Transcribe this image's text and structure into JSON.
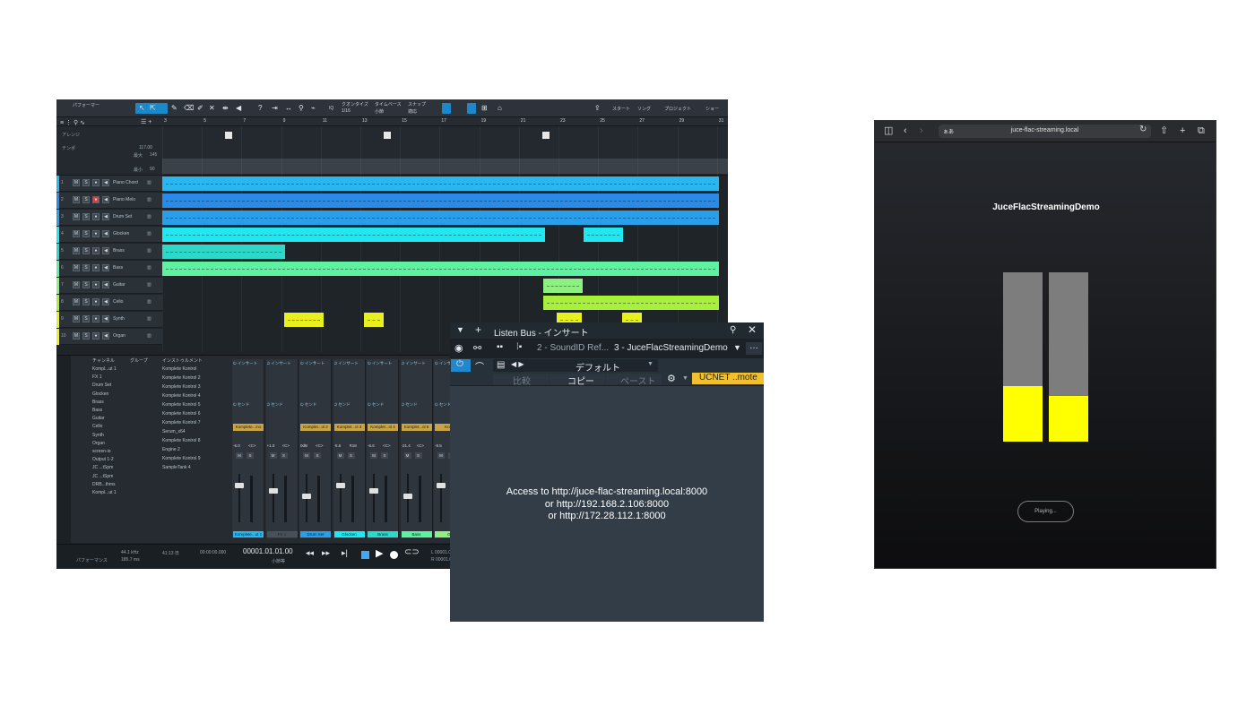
{
  "daw": {
    "toolbar": {
      "performance_label": "パフォーマー",
      "quantize_label": "クオンタイズ",
      "quantize_value": "1/16",
      "timebase_label": "タイムベース",
      "timebase_value": "小節",
      "snap_label": "スナップ",
      "snap_value": "適応",
      "start_label": "スタート",
      "song_label": "ソング",
      "project_label": "プロジェクト",
      "show_label": "ショー"
    },
    "ruler": [
      "3",
      "5",
      "7",
      "9",
      "11",
      "13",
      "15",
      "17",
      "19",
      "21",
      "23",
      "25",
      "27",
      "29",
      "31"
    ],
    "global": {
      "arranger_label": "アレンジ",
      "tempo_label": "テンポ",
      "tempo_value": "117.00",
      "max_label": "最大",
      "max_value": "145",
      "min_label": "最小",
      "min_value": "90"
    },
    "tracks": [
      {
        "num": "1",
        "name": "Piano Chord",
        "color": "#2ab7f0"
      },
      {
        "num": "2",
        "name": "Piano Melo",
        "color": "#2a8ae8"
      },
      {
        "num": "3",
        "name": "Drum Set",
        "color": "#2a9ee8"
      },
      {
        "num": "4",
        "name": "Glocken",
        "color": "#20e8f0"
      },
      {
        "num": "5",
        "name": "Brass",
        "color": "#2ed8c8"
      },
      {
        "num": "6",
        "name": "Bass",
        "color": "#5ef2a0"
      },
      {
        "num": "7",
        "name": "Guitar",
        "color": "#8ef080"
      },
      {
        "num": "8",
        "name": "Cello",
        "color": "#a8f03a"
      },
      {
        "num": "9",
        "name": "Synth",
        "color": "#e8f020"
      },
      {
        "num": "10",
        "name": "Organ",
        "color": "#f0f020"
      }
    ],
    "console": {
      "header_channel": "チャンネル",
      "header_group": "グループ",
      "header_instrument": "インストゥルメント",
      "channels": [
        "Kompl...ut 1",
        "FX 1",
        "Drum Set",
        "Glocken",
        "Brass",
        "Bass",
        "Guitar",
        "Cello",
        "Synth",
        "Organ",
        "screen-io",
        "Output 1-2",
        "JC ...tSpm",
        "JC ...tSpm",
        "DRB...thms",
        "Kompl...ut 1"
      ],
      "instruments": [
        "Komplete Kontrol",
        "Komplete Kontrol 2",
        "Komplete Kontrol 3",
        "Komplete Kontrol 4",
        "Komplete Kontrol 5",
        "Komplete Kontrol 6",
        "Komplete Kontrol 7",
        "Serum_x64",
        "Komplete Kontrol 8",
        "Engine 2",
        "Komplete Kontrol 9",
        "SampleTank 4"
      ],
      "strips": [
        {
          "name": "Komplete...ut 1",
          "label": "Komplete...ino",
          "vol": "-6.0",
          "pan": "<C>",
          "color": "#2ab7f0"
        },
        {
          "name": "FX 1",
          "label": "",
          "vol": "+1.0",
          "pan": "<C>",
          "color": "#4a5058"
        },
        {
          "name": "Drum Set",
          "label": "Komplet...ol 2",
          "vol": "0dB",
          "pan": "<C>",
          "color": "#2a9ee8"
        },
        {
          "name": "Glocken",
          "label": "Komplet...ol 3",
          "vol": "-5.5",
          "pan": "R18",
          "color": "#20e8f0"
        },
        {
          "name": "Brass",
          "label": "Komplet...ol 4",
          "vol": "-6.6",
          "pan": "<C>",
          "color": "#2ed8c8"
        },
        {
          "name": "Bass",
          "label": "Komplet...ol 5",
          "vol": "-21.4",
          "pan": "<C>",
          "color": "#5ef2a0"
        },
        {
          "name": "Gu",
          "label": "Komp",
          "vol": "-9.5",
          "pan": "",
          "color": "#8ef080"
        }
      ],
      "insert_label": "インサート",
      "send_label": "センド"
    },
    "transport": {
      "sample_rate": "44.1 kHz",
      "latency": "185.7 ms",
      "time_remaining": "41:13 日",
      "time_code": "00:00:00.000",
      "position": "00001.01.01.00",
      "position_sub": "小節等",
      "perf_label": "パフォーマンス",
      "l_value": "L 00001.0",
      "r_value": "R 00001.0"
    }
  },
  "plugin": {
    "title": "Listen Bus - インサート",
    "slot_prev": "2 - SoundID Ref...",
    "slot_current": "3 - JuceFlacStreamingDemo",
    "preset": "デフォルト",
    "compare_label": "比較",
    "copy_label": "コピー",
    "paste_label": "ペースト",
    "ucnet_label": "UCNET ..mote",
    "access_lines": [
      "Access to http://juce-flac-streaming.local:8000",
      "or http://192.168.2.106:8000",
      "or http://172.28.112.1:8000"
    ],
    "colors": {
      "bg": "#323d47",
      "accent": "#f0c030",
      "active": "#2188d0"
    }
  },
  "browser": {
    "locale_label": "ぁあ",
    "url": "juce-flac-streaming.local",
    "app_title": "JuceFlacStreamingDemo",
    "levels": {
      "left": 0.33,
      "right": 0.27
    },
    "playing_label": "Playing...",
    "colors": {
      "meter_bg": "#7d7d7d",
      "meter_fill": "#ffff00"
    }
  }
}
